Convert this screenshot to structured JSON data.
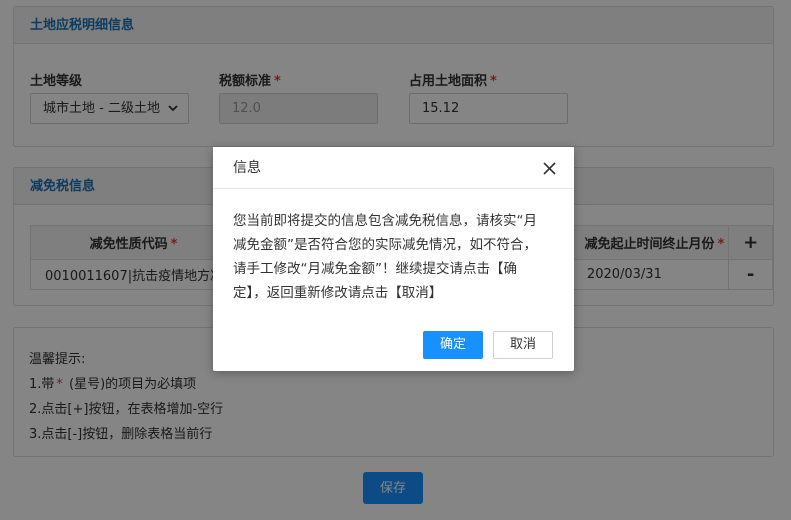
{
  "land_panel": {
    "title": "土地应税明细信息",
    "land_grade_label": "土地等级",
    "land_grade_value": "城市土地 - 二级土地",
    "tax_standard_label": "税额标准",
    "tax_standard_value": "12.0",
    "area_label": "占用土地面积",
    "area_value": "15.12",
    "required_mark": "*"
  },
  "relief_panel": {
    "title": "减免税信息",
    "col_code": "减免性质代码",
    "col_period": "减免起止时间终止月份",
    "add_symbol": "+",
    "remove_symbol": "-",
    "row_code": "0010011607|抗击疫情地方减免",
    "row_end_month": "2020/03/31",
    "required_mark": "*"
  },
  "tips": {
    "heading": "温馨提示:",
    "line1_prefix": "1.带",
    "line1_star": "*",
    "line1_suffix": " (星号)的项目为必填项",
    "line2": "2.点击[+]按钮，在表格增加-空行",
    "line3": "3.点击[-]按钮，删除表格当前行"
  },
  "save_label": "保存",
  "dialog": {
    "title": "信息",
    "line1": "您当前即将提交的信息包含减免税信息，请核实“月",
    "line2": "减免金额”是否符合您的实际减免情况，如不符合，",
    "line3": "请手工修改“月减免金额”！继续提交请点击【确",
    "line4": "定】，返回重新修改请点击【取消】",
    "ok_label": "确定",
    "cancel_label": "取消"
  },
  "colors": {
    "accent": "#1890ff",
    "header_text": "#1a73b8",
    "required": "#e53935"
  }
}
